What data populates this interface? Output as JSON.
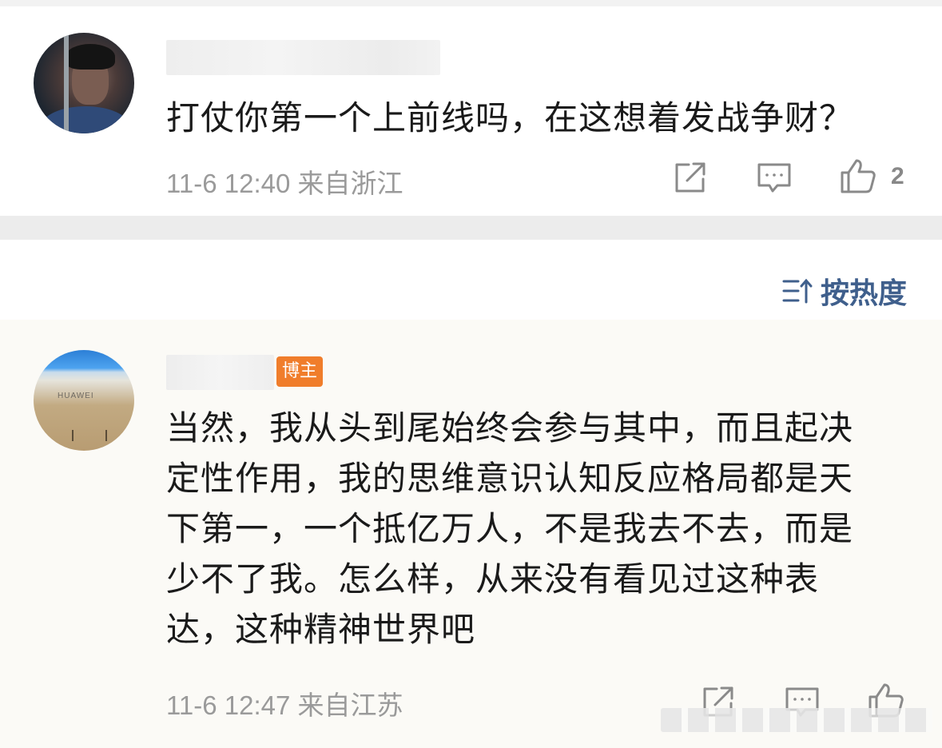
{
  "comments": [
    {
      "avatar_icon": "user-avatar-photo",
      "text": "打仗你第一个上前线吗，在这想着发战争财？",
      "time": "11-6 12:40",
      "location": "来自浙江",
      "meta": "11-6 12:40 来自浙江",
      "likes": "2",
      "actions": [
        "share-icon",
        "comment-icon",
        "like-icon"
      ]
    },
    {
      "avatar_icon": "user-avatar-photo",
      "badge": "博主",
      "text": "当然，我从头到尾始终会参与其中，而且起决定性作用，我的思维意识认知反应格局都是天下第一，一个抵亿万人，不是我去不去，而是少不了我。怎么样，从来没有看见过这种表达，这种精神世界吧",
      "lines": [
        "当然，我从头到尾始终会参与其中，而且起决",
        "定性作用，我的思维意识认知反应格局都是天",
        "下第一，一个抵亿万人，不是我去不去，而是",
        "少不了我。怎么样，从来没有看见过这种表",
        "达，这种精神世界吧"
      ],
      "time": "11-6 12:47",
      "location": "来自江苏",
      "meta": "11-6 12:47 来自江苏",
      "actions": [
        "share-icon",
        "comment-icon",
        "like-icon"
      ]
    }
  ],
  "sort": {
    "label": "按热度",
    "icon": "sort-icon"
  },
  "colors": {
    "text": "#1a1a1a",
    "meta": "#9a9a9a",
    "sort_accent": "#3f5f8c",
    "badge": "#f07d2b",
    "divider": "#ececec"
  }
}
